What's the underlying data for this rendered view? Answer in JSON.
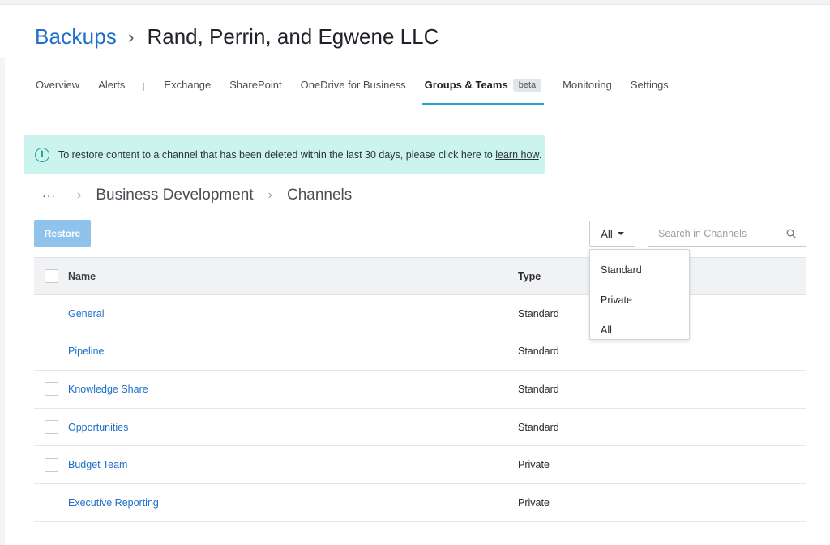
{
  "header": {
    "root": "Backups",
    "separator": "›",
    "current": "Rand, Perrin, and Egwene LLC"
  },
  "tabs": [
    {
      "label": "Overview"
    },
    {
      "label": "Alerts"
    },
    {
      "label": "Exchange"
    },
    {
      "label": "SharePoint"
    },
    {
      "label": "OneDrive for Business"
    },
    {
      "label": "Groups & Teams",
      "badge": "beta",
      "active": true
    },
    {
      "label": "Monitoring"
    },
    {
      "label": "Settings"
    }
  ],
  "info": {
    "text": "To restore content to a channel that has been deleted within the last 30 days, please click here to",
    "link": "learn how",
    "suffix": "."
  },
  "path": {
    "dots": "···",
    "items": [
      "Business Development",
      "Channels"
    ]
  },
  "toolbar": {
    "restore_label": "Restore",
    "filter_value": "All",
    "search_placeholder": "Search in Channels"
  },
  "table": {
    "columns": [
      "Name",
      "Type"
    ],
    "rows": [
      {
        "name": "General",
        "type": "Standard"
      },
      {
        "name": "Pipeline",
        "type": "Standard"
      },
      {
        "name": "Knowledge Share",
        "type": "Standard"
      },
      {
        "name": "Opportunities",
        "type": "Standard"
      },
      {
        "name": "Budget Team",
        "type": "Private"
      },
      {
        "name": "Executive Reporting",
        "type": "Private"
      }
    ]
  },
  "dropdown": {
    "options": [
      "Standard",
      "Private",
      "All"
    ]
  },
  "colors": {
    "accent": "#1e6fc9",
    "tab_underline": "#29a3cc",
    "info_bg": "#cbf4ee",
    "restore_disabled": "#8fc3ec"
  }
}
